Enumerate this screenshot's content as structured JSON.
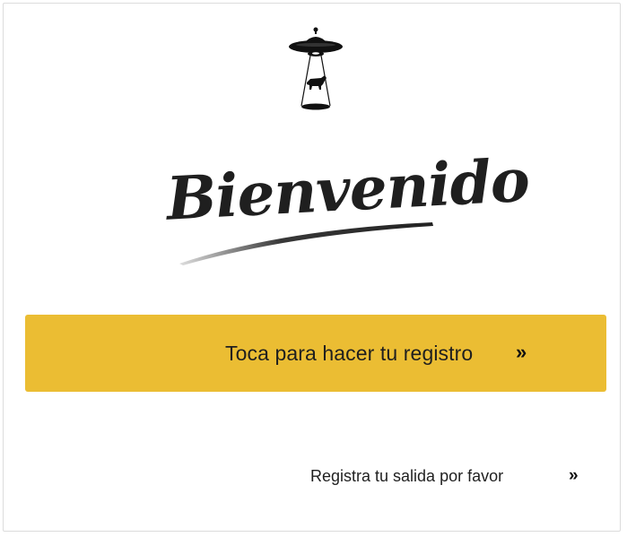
{
  "header": {
    "logo_icon": "ufo-abducting-cow-icon",
    "welcome_title": "Bienvenido"
  },
  "actions": {
    "register_label": "Toca para hacer tu registro",
    "register_icon": "double-chevron-right-icon",
    "checkout_label": "Registra tu salida por favor",
    "checkout_icon": "double-chevron-right-icon"
  },
  "colors": {
    "accent": "#ebbd33",
    "text": "#1f1f1f",
    "card_border": "#dcdcdc"
  }
}
